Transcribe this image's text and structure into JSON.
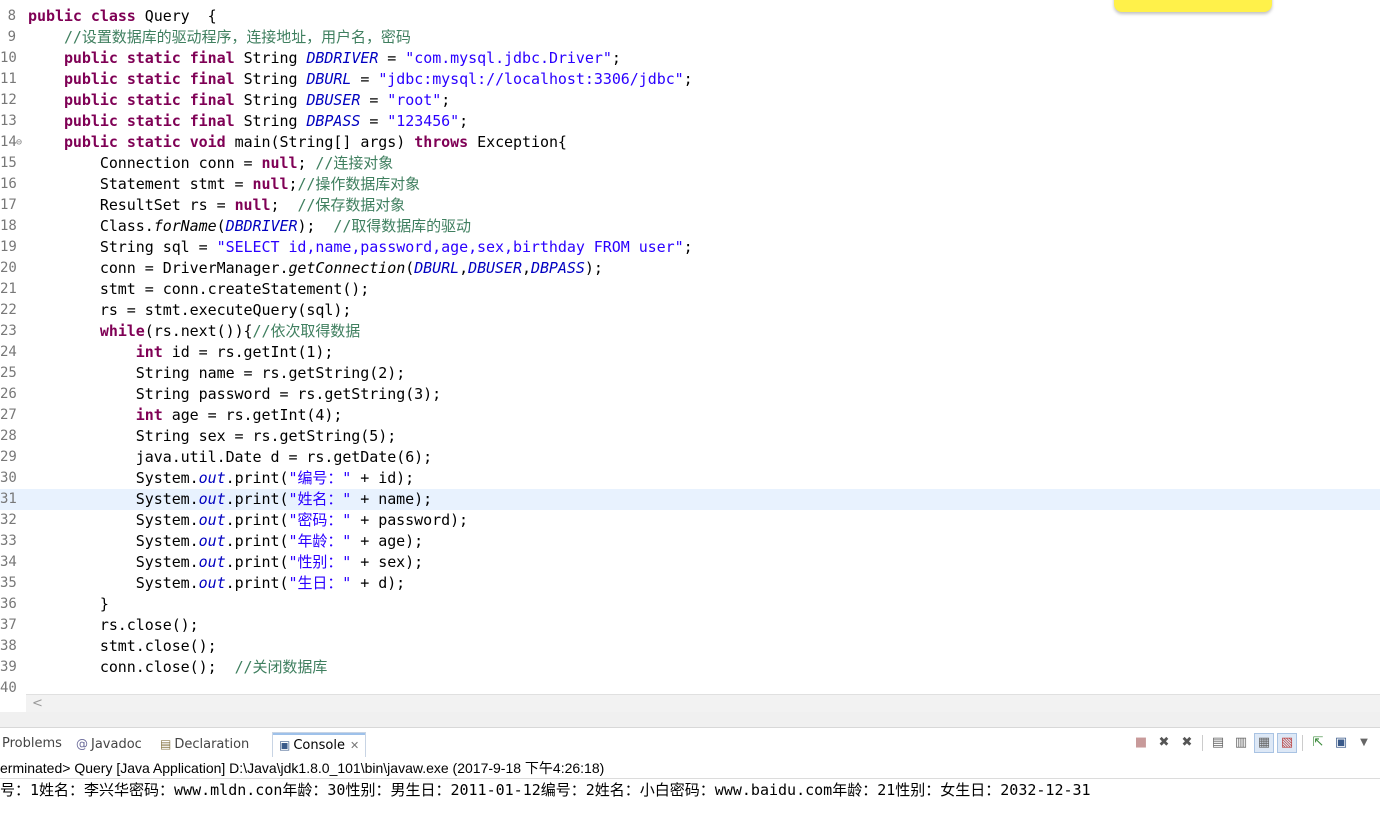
{
  "editor": {
    "lines": [
      {
        "n": "8",
        "html": "<span class=\"kw\">public</span> <span class=\"kw\">class</span> Query  {"
      },
      {
        "n": "9",
        "html": "    <span class=\"cmt\">//设置数据库的驱动程序，连接地址，用户名，密码</span>"
      },
      {
        "n": "10",
        "html": "    <span class=\"kw\">public</span> <span class=\"kw\">static</span> <span class=\"kw\">final</span> String <span class=\"fld\">DBDRIVER</span> = <span class=\"str\">\"com.mysql.jdbc.Driver\"</span>;"
      },
      {
        "n": "11",
        "html": "    <span class=\"kw\">public</span> <span class=\"kw\">static</span> <span class=\"kw\">final</span> String <span class=\"fld\">DBURL</span> = <span class=\"str\">\"jdbc:mysql://localhost:3306/jdbc\"</span>;"
      },
      {
        "n": "12",
        "html": "    <span class=\"kw\">public</span> <span class=\"kw\">static</span> <span class=\"kw\">final</span> String <span class=\"fld\">DBUSER</span> = <span class=\"str\">\"root\"</span>;"
      },
      {
        "n": "13",
        "html": "    <span class=\"kw\">public</span> <span class=\"kw\">static</span> <span class=\"kw\">final</span> String <span class=\"fld\">DBPASS</span> = <span class=\"str\">\"123456\"</span>;"
      },
      {
        "n": "14",
        "fold": true,
        "html": "    <span class=\"kw\">public</span> <span class=\"kw\">static</span> <span class=\"kw\">void</span> main(String[] args) <span class=\"kw\">throws</span> Exception{"
      },
      {
        "n": "15",
        "html": "        Connection conn = <span class=\"kw\">null</span>; <span class=\"cmt\">//连接对象</span>"
      },
      {
        "n": "16",
        "html": "        Statement stmt = <span class=\"kw\">null</span>;<span class=\"cmt\">//操作数据库对象</span>"
      },
      {
        "n": "17",
        "html": "        ResultSet rs = <span class=\"kw\">null</span>;  <span class=\"cmt\">//保存数据对象</span>"
      },
      {
        "n": "18",
        "html": "        Class.<span class=\"st\">forName</span>(<span class=\"fld\">DBDRIVER</span>);  <span class=\"cmt\">//取得数据库的驱动</span>"
      },
      {
        "n": "19",
        "html": "        String sql = <span class=\"str\">\"SELECT id,name,password,age,sex,birthday FROM user\"</span>;"
      },
      {
        "n": "20",
        "html": "        conn = DriverManager.<span class=\"st\">getConnection</span>(<span class=\"fld\">DBURL</span>,<span class=\"fld\">DBUSER</span>,<span class=\"fld\">DBPASS</span>);"
      },
      {
        "n": "21",
        "html": "        stmt = conn.createStatement();"
      },
      {
        "n": "22",
        "html": "        rs = stmt.executeQuery(sql);"
      },
      {
        "n": "23",
        "html": "        <span class=\"kw\">while</span>(rs.next()){<span class=\"cmt\">//依次取得数据</span>"
      },
      {
        "n": "24",
        "html": "            <span class=\"kw\">int</span> id = rs.getInt(1);"
      },
      {
        "n": "25",
        "html": "            String name = rs.getString(2);"
      },
      {
        "n": "26",
        "html": "            String password = rs.getString(3);"
      },
      {
        "n": "27",
        "html": "            <span class=\"kw\">int</span> age = rs.getInt(4);"
      },
      {
        "n": "28",
        "html": "            String sex = rs.getString(5);"
      },
      {
        "n": "29",
        "html": "            java.util.Date d = rs.getDate(6);"
      },
      {
        "n": "30",
        "html": "            System.<span class=\"fld\">out</span>.print(<span class=\"str\">\"编号：\"</span> + id);"
      },
      {
        "n": "31",
        "current": true,
        "html": "            System.<span class=\"fld\">out</span>.print(<span class=\"str\">\"姓名：\"</span> + name);"
      },
      {
        "n": "32",
        "html": "            System.<span class=\"fld\">out</span>.print(<span class=\"str\">\"密码：\"</span> + password);"
      },
      {
        "n": "33",
        "html": "            System.<span class=\"fld\">out</span>.print(<span class=\"str\">\"年龄：\"</span> + age);"
      },
      {
        "n": "34",
        "html": "            System.<span class=\"fld\">out</span>.print(<span class=\"str\">\"性别：\"</span> + sex);"
      },
      {
        "n": "35",
        "html": "            System.<span class=\"fld\">out</span>.print(<span class=\"str\">\"生日：\"</span> + d);"
      },
      {
        "n": "36",
        "html": "        }"
      },
      {
        "n": "37",
        "html": "        rs.close();"
      },
      {
        "n": "38",
        "html": "        stmt.close();"
      },
      {
        "n": "39",
        "html": "        conn.close();  <span class=\"cmt\">//关闭数据库</span>"
      },
      {
        "n": "40",
        "html": ""
      }
    ]
  },
  "bottom_panel": {
    "tabs": {
      "problems": "Problems",
      "javadoc": "Javadoc",
      "declaration": "Declaration",
      "console": "Console"
    },
    "status_line": "erminated> Query [Java Application] D:\\Java\\jdk1.8.0_101\\bin\\javaw.exe (2017-9-18 下午4:26:18)",
    "output_line": "号：1姓名：李兴华密码：www.mldn.con年龄：30性别：男生日：2011-01-12编号：2姓名：小白密码：www.baidu.com年龄：21性别：女生日：2032-12-31"
  },
  "icons": {
    "fold": "collapse-minus-icon",
    "scroll_left": "scroll-left-arrow-icon"
  }
}
